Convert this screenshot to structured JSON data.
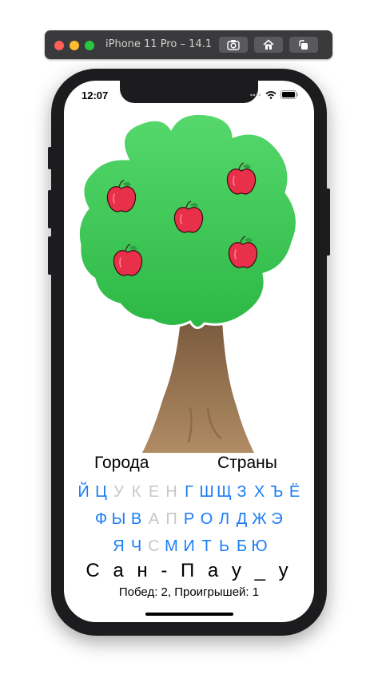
{
  "simulator": {
    "title": "iPhone 11 Pro – 14.1",
    "buttons": [
      "camera-icon",
      "home-icon",
      "rotate-icon"
    ]
  },
  "status_bar": {
    "time": "12:07"
  },
  "game": {
    "categories": [
      "Города",
      "Страны"
    ],
    "keyboard": {
      "rows": [
        [
          {
            "l": "Й",
            "enabled": true
          },
          {
            "l": "Ц",
            "enabled": true
          },
          {
            "l": "У",
            "enabled": false
          },
          {
            "l": "К",
            "enabled": false
          },
          {
            "l": "Е",
            "enabled": false
          },
          {
            "l": "Н",
            "enabled": false
          },
          {
            "l": "Г",
            "enabled": true
          },
          {
            "l": "Ш",
            "enabled": true
          },
          {
            "l": "Щ",
            "enabled": true
          },
          {
            "l": "З",
            "enabled": true
          },
          {
            "l": "Х",
            "enabled": true
          },
          {
            "l": "Ъ",
            "enabled": true
          },
          {
            "l": "Ё",
            "enabled": true
          }
        ],
        [
          {
            "l": "Ф",
            "enabled": true
          },
          {
            "l": "Ы",
            "enabled": true
          },
          {
            "l": "В",
            "enabled": true
          },
          {
            "l": "А",
            "enabled": false
          },
          {
            "l": "П",
            "enabled": false
          },
          {
            "l": "Р",
            "enabled": true
          },
          {
            "l": "О",
            "enabled": true
          },
          {
            "l": "Л",
            "enabled": true
          },
          {
            "l": "Д",
            "enabled": true
          },
          {
            "l": "Ж",
            "enabled": true
          },
          {
            "l": "Э",
            "enabled": true
          }
        ],
        [
          {
            "l": "Я",
            "enabled": true
          },
          {
            "l": "Ч",
            "enabled": true
          },
          {
            "l": "С",
            "enabled": false
          },
          {
            "l": "М",
            "enabled": true
          },
          {
            "l": "И",
            "enabled": true
          },
          {
            "l": "Т",
            "enabled": true
          },
          {
            "l": "Ь",
            "enabled": true
          },
          {
            "l": "Б",
            "enabled": true
          },
          {
            "l": "Ю",
            "enabled": true
          }
        ]
      ]
    },
    "word": "С а н - П а у _ у",
    "score": "Побед: 2, Проигрышей: 1",
    "apples_remaining": 5
  },
  "colors": {
    "key_enabled": "#1a7df5",
    "key_disabled": "#c7c7cc",
    "foliage": "#3cc85a",
    "trunk": "#9a7550",
    "apple": "#e8304a"
  }
}
